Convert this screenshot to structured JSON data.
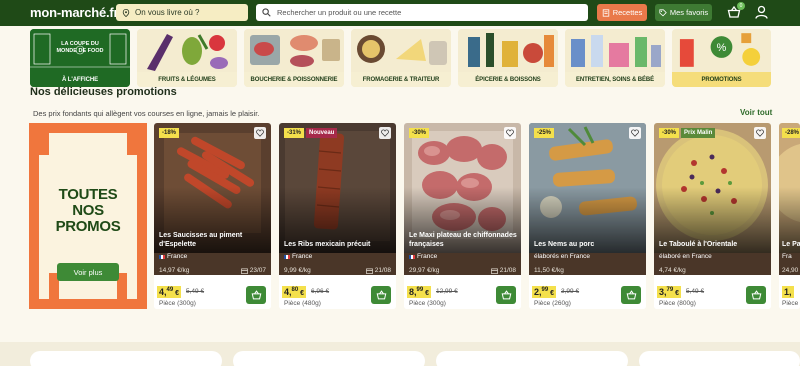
{
  "header": {
    "logo": "mon-marché.fr",
    "address_placeholder": "On vous livre où ?",
    "search_placeholder": "Rechercher un produit ou une recette",
    "recettes_label": "Recettes",
    "favoris_label": "Mes favoris",
    "cart_count": "0"
  },
  "categories": [
    {
      "label": "À l'affiche",
      "art_text": "LA COUPE DU MONDE DE FOOD"
    },
    {
      "label": "Fruits & Légumes"
    },
    {
      "label": "Boucherie & Poissonnerie"
    },
    {
      "label": "Fromagerie & Traiteur"
    },
    {
      "label": "Épicerie & Boissons"
    },
    {
      "label": "Entretien, Soins & Bébé"
    },
    {
      "label": "Promotions"
    }
  ],
  "section": {
    "title": "Nos délicieuses promotions",
    "subtitle": "Des prix fondants qui allègent vos courses en ligne, jamais le plaisir.",
    "see_all": "Voir tout"
  },
  "promo_card": {
    "line1": "TOUTES",
    "line2": "NOS",
    "line3": "PROMOS",
    "button": "Voir plus"
  },
  "products": [
    {
      "discount": "-18%",
      "tag": "",
      "name": "Les Saucisses au piment d'Espelette",
      "origin": "France",
      "price_per_kg": "14,97 €/kg",
      "date": "23/07",
      "price_int": "4,",
      "price_dec": "49",
      "price_euro": " €",
      "old_price": "5,49 €",
      "unit": "Pièce (300g)"
    },
    {
      "discount": "-31%",
      "tag": "Nouveau",
      "name": "Les Ribs mexicain précuit",
      "origin": "France",
      "price_per_kg": "9,99 €/kg",
      "date": "21/08",
      "price_int": "4,",
      "price_dec": "80",
      "price_euro": " €",
      "old_price": "6,96 €",
      "unit": "Pièce (480g)"
    },
    {
      "discount": "-30%",
      "tag": "",
      "name": "Le Maxi plateau de chiffonnades françaises",
      "origin": "France",
      "price_per_kg": "29,97 €/kg",
      "date": "21/08",
      "price_int": "8,",
      "price_dec": "99",
      "price_euro": " €",
      "old_price": "12,99 €",
      "unit": "Pièce (300g)"
    },
    {
      "discount": "-25%",
      "tag": "",
      "name": "Les Nems au porc",
      "origin": "élaborés en France",
      "price_per_kg": "11,50 €/kg",
      "date": "",
      "price_int": "2,",
      "price_dec": "99",
      "price_euro": " €",
      "old_price": "3,99 €",
      "unit": "Pièce (260g)"
    },
    {
      "discount": "-30%",
      "tag": "Prix Malin",
      "name": "Le Taboulé à l'Orientale",
      "origin": "élaboré en France",
      "price_per_kg": "4,74 €/kg",
      "date": "",
      "price_int": "3,",
      "price_dec": "79",
      "price_euro": " €",
      "old_price": "5,49 €",
      "unit": "Pièce (800g)"
    },
    {
      "discount": "-28%",
      "tag": "",
      "name": "Le Pa",
      "origin": "Fra",
      "price_per_kg": "24,90",
      "date": "",
      "price_int": "1,",
      "price_dec": "",
      "price_euro": "",
      "old_price": "",
      "unit": "Pièce"
    }
  ]
}
